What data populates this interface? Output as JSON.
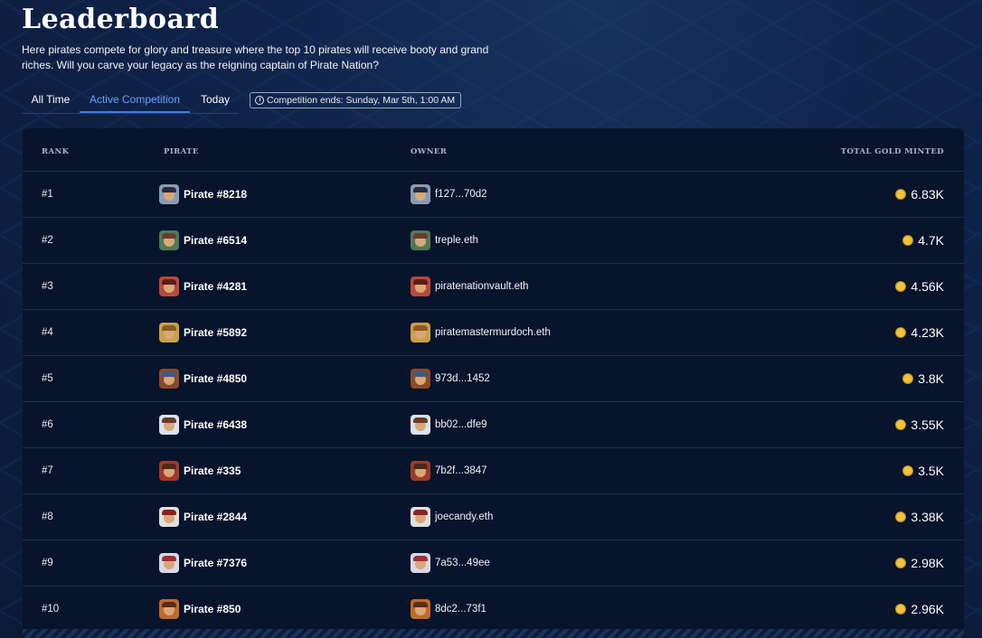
{
  "page": {
    "title": "Leaderboard",
    "description": "Here pirates compete for glory and treasure where the top 10 pirates will receive booty and grand riches. Will you carve your legacy as the reigning captain of Pirate Nation?"
  },
  "tabs": [
    {
      "label": "All Time",
      "active": false
    },
    {
      "label": "Active Competition",
      "active": true
    },
    {
      "label": "Today",
      "active": false
    }
  ],
  "competition_badge": {
    "icon": "clock-icon",
    "text": "Competition ends: Sunday, Mar 5th, 1:00 AM"
  },
  "table": {
    "columns": [
      "RANK",
      "PIRATE",
      "OWNER",
      "TOTAL GOLD MINTED"
    ],
    "rows": [
      {
        "rank": "#1",
        "pirate": "Pirate #8218",
        "owner": "f127...70d2",
        "gold": "6.83K"
      },
      {
        "rank": "#2",
        "pirate": "Pirate #6514",
        "owner": "treple.eth",
        "gold": "4.7K"
      },
      {
        "rank": "#3",
        "pirate": "Pirate #4281",
        "owner": "piratenationvault.eth",
        "gold": "4.56K"
      },
      {
        "rank": "#4",
        "pirate": "Pirate #5892",
        "owner": "piratemastermurdoch.eth",
        "gold": "4.23K"
      },
      {
        "rank": "#5",
        "pirate": "Pirate #4850",
        "owner": "973d...1452",
        "gold": "3.8K"
      },
      {
        "rank": "#6",
        "pirate": "Pirate #6438",
        "owner": "bb02...dfe9",
        "gold": "3.55K"
      },
      {
        "rank": "#7",
        "pirate": "Pirate #335",
        "owner": "7b2f...3847",
        "gold": "3.5K"
      },
      {
        "rank": "#8",
        "pirate": "Pirate #2844",
        "owner": "joecandy.eth",
        "gold": "3.38K"
      },
      {
        "rank": "#9",
        "pirate": "Pirate #7376",
        "owner": "7a53...49ee",
        "gold": "2.98K"
      },
      {
        "rank": "#10",
        "pirate": "Pirate #850",
        "owner": "8dc2...73f1",
        "gold": "2.96K"
      }
    ]
  },
  "colors": {
    "accent": "#3f7de8",
    "panel": "#08142b",
    "background": "#0f2248",
    "coin": "#f0c33c"
  }
}
